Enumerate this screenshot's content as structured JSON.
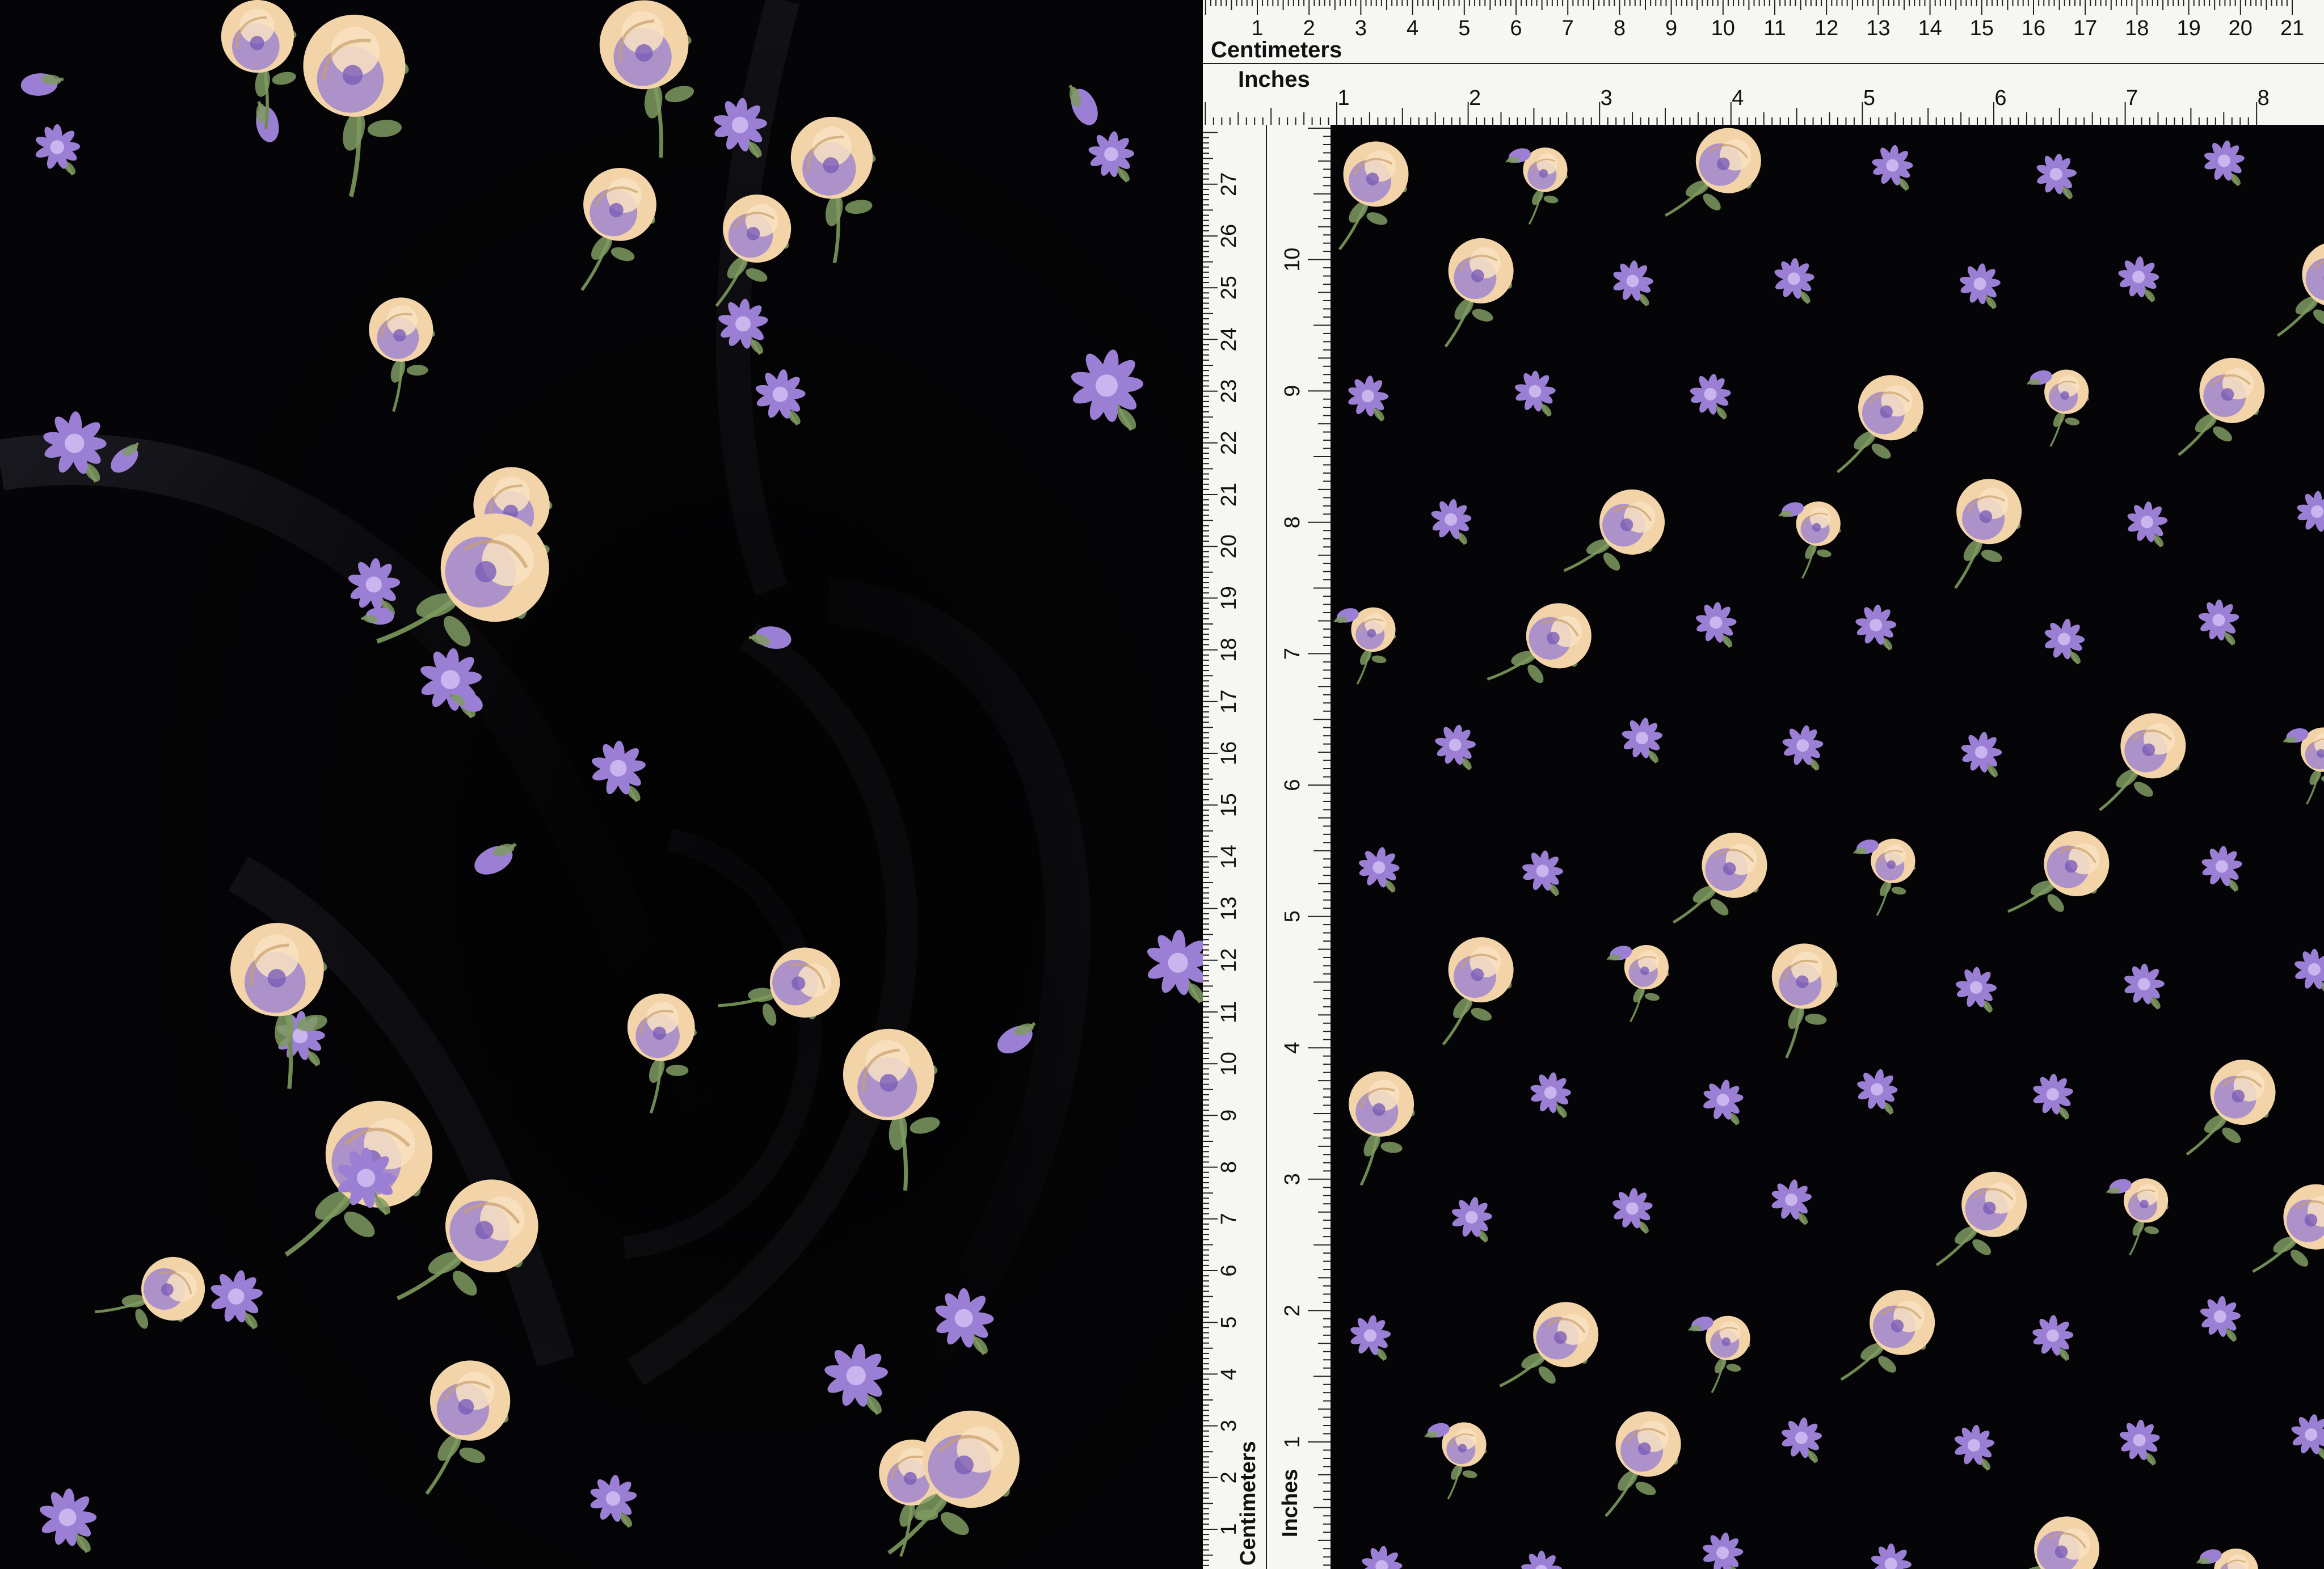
{
  "ruler": {
    "top_cm_label": "Centimeters",
    "top_in_label": "Inches",
    "side_cm_label": "Centimeters",
    "side_in_label": "Inches",
    "cm_numbers": [
      1,
      2,
      3,
      4,
      5,
      6,
      7,
      8,
      9,
      10,
      11,
      12,
      13,
      14,
      15,
      16,
      17,
      18,
      19,
      20,
      21
    ],
    "in_numbers": [
      1,
      2,
      3,
      4,
      5,
      6,
      7,
      8
    ],
    "side_cm_numbers": [
      1,
      2,
      3,
      4,
      5,
      6,
      7,
      8,
      9,
      10,
      11,
      12,
      13,
      14,
      15,
      16,
      17,
      18,
      19,
      20,
      21,
      22,
      23,
      24,
      25,
      26,
      27
    ],
    "side_in_numbers": [
      1,
      2,
      3,
      4,
      5,
      6,
      7,
      8,
      9,
      10
    ]
  },
  "colors": {
    "fabric_black": "#050507",
    "ruler_bg": "#f6f6f2",
    "ruler_ink": "#111111",
    "rose_cream": "#f3d3a8",
    "rose_lavender": "#9a82cf",
    "daisy_violet": "#9b7fd4",
    "leaf_green": "#7f9a62"
  },
  "icons": {
    "rose": "rose-motif-icon",
    "daisy": "daisy-motif-icon",
    "bud": "bud-motif-icon"
  }
}
